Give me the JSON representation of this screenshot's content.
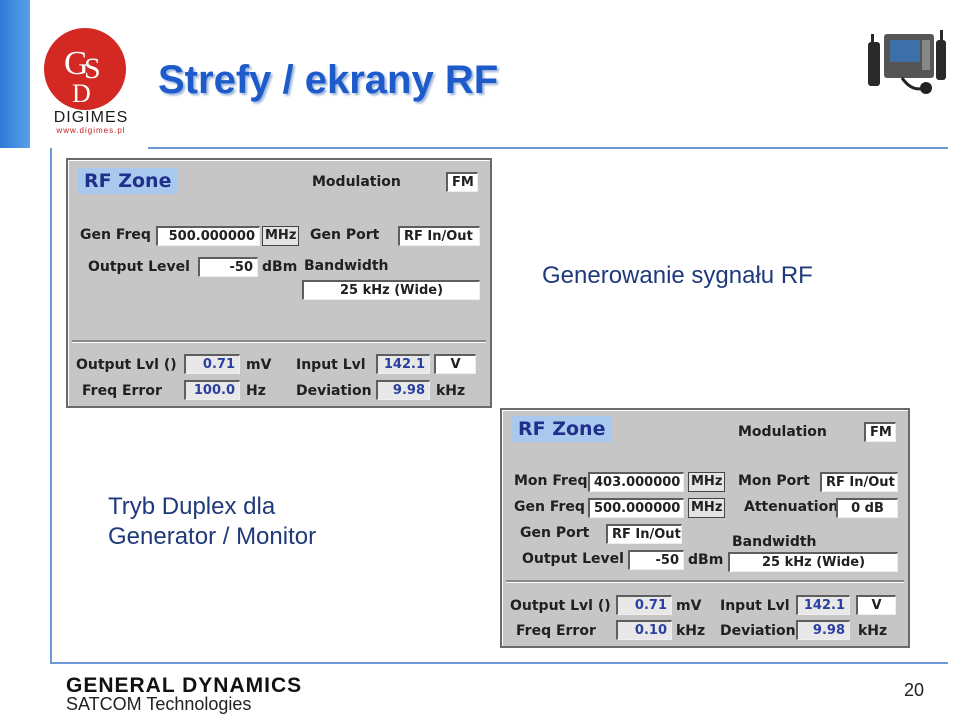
{
  "header": {
    "title": "Strefy / ekrany RF",
    "logo_word": "DIGIMES",
    "logo_url": "www.digimes.pl"
  },
  "captions": {
    "top": "Generowanie sygnału RF",
    "bottom_line1": "Tryb Duplex dla",
    "bottom_line2": "Generator / Monitor"
  },
  "panel1": {
    "zone_label": "RF Zone",
    "modulation_label": "Modulation",
    "modulation_value": "FM",
    "gen_freq_label": "Gen Freq",
    "gen_freq_value": "500.000000",
    "gen_freq_unit": "MHz",
    "gen_port_label": "Gen Port",
    "gen_port_value": "RF In/Out",
    "output_level_label": "Output Level",
    "output_level_value": "-50",
    "output_level_unit": "dBm",
    "bandwidth_label": "Bandwidth",
    "bandwidth_value": "25 kHz (Wide)",
    "output_lvl_label": "Output Lvl ()",
    "output_lvl_value": "0.71",
    "output_lvl_unit": "mV",
    "input_lvl_label": "Input Lvl",
    "input_lvl_value": "142.1",
    "input_lvl_unit": "V",
    "freq_error_label": "Freq Error",
    "freq_error_value": "100.0",
    "freq_error_unit": "Hz",
    "deviation_label": "Deviation",
    "deviation_value": "9.98",
    "deviation_unit": "kHz"
  },
  "panel2": {
    "zone_label": "RF Zone",
    "modulation_label": "Modulation",
    "modulation_value": "FM",
    "mon_freq_label": "Mon Freq",
    "mon_freq_value": "403.000000",
    "mon_freq_unit": "MHz",
    "mon_port_label": "Mon Port",
    "mon_port_value": "RF In/Out",
    "gen_freq_label": "Gen Freq",
    "gen_freq_value": "500.000000",
    "gen_freq_unit": "MHz",
    "attenuation_label": "Attenuation",
    "attenuation_value": "0 dB",
    "gen_port_label": "Gen Port",
    "gen_port_value": "RF In/Out",
    "bandwidth_label": "Bandwidth",
    "bandwidth_value": "25 kHz (Wide)",
    "output_level_label": "Output Level",
    "output_level_value": "-50",
    "output_level_unit": "dBm",
    "output_lvl_label": "Output Lvl ()",
    "output_lvl_value": "0.71",
    "output_lvl_unit": "mV",
    "input_lvl_label": "Input Lvl",
    "input_lvl_value": "142.1",
    "input_lvl_unit": "V",
    "freq_error_label": "Freq Error",
    "freq_error_value": "0.10",
    "freq_error_unit": "kHz",
    "deviation_label": "Deviation",
    "deviation_value": "9.98",
    "deviation_unit": "kHz"
  },
  "footer": {
    "company": "GENERAL DYNAMICS",
    "division": "SATCOM Technologies",
    "page_number": "20"
  },
  "colors": {
    "title": "#1c5bc9",
    "accent_line": "#6d9ad6",
    "zone_bg": "#a9c8ee",
    "panel_bg": "#c6c6c6"
  }
}
